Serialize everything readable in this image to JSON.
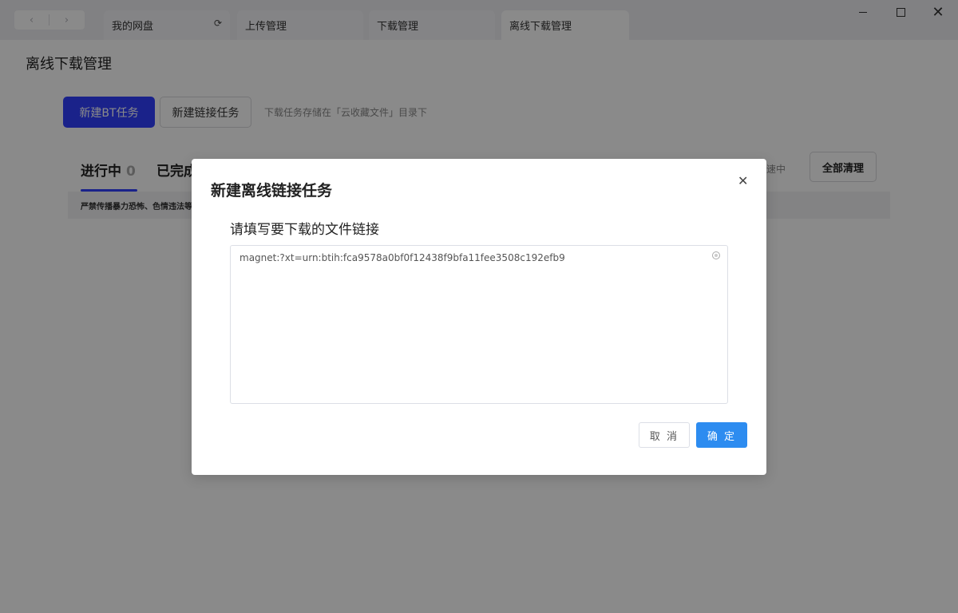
{
  "titlebar": {
    "nav": {
      "back": "‹",
      "forward": "›"
    },
    "tabs": [
      {
        "label": "我的网盘",
        "refresh_icon": "refresh-icon"
      },
      {
        "label": "上传管理"
      },
      {
        "label": "下载管理"
      },
      {
        "label": "离线下载管理",
        "active": true
      }
    ],
    "window_controls": {
      "close": "✕"
    }
  },
  "page": {
    "title": "离线下载管理",
    "new_bt_button": "新建BT任务",
    "new_link_button": "新建链接任务",
    "hint": "下载任务存储在「云收藏文件」目录下",
    "tabs": [
      {
        "label": "进行中",
        "count": "0"
      },
      {
        "label": "已完成"
      }
    ],
    "status_right": "速中",
    "clear_all_button": "全部清理",
    "warning": "严禁传播暴力恐怖、色情违法等"
  },
  "modal": {
    "title": "新建离线链接任务",
    "close": "✕",
    "label": "请填写要下载的文件链接",
    "textarea_value": "magnet:?xt=urn:btih:fca9578a0bf0f12438f9bfa11fee3508c192efb9",
    "cancel_button": "取 消",
    "confirm_button": "确 定"
  },
  "colors": {
    "primary": "#3040ff",
    "confirm": "#2d8cf0",
    "overlay": "rgba(0,0,0,0.46)"
  }
}
